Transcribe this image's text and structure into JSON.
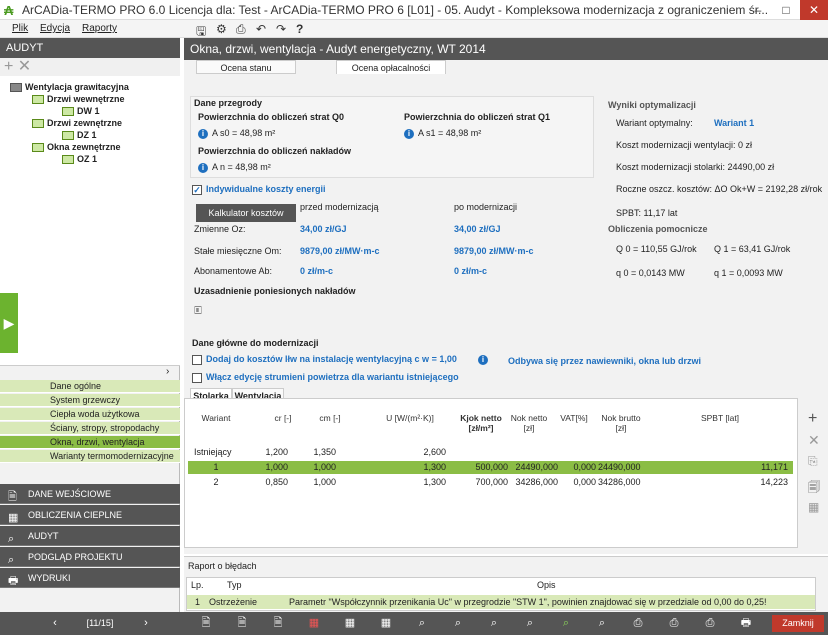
{
  "title": "ArCADia-TERMO PRO 6.0 Licencja dla: Test - ArCADia-TERMO PRO 6 [L01] - 05. Audyt - Kompleksowa modernizacja z ograniczeniem śr...",
  "menu": [
    "Plik",
    "Edycja",
    "Raporty"
  ],
  "left": {
    "header": "AUDYT",
    "tree": [
      "Wentylacja grawitacyjna",
      "Drzwi wewnętrzne",
      "DW 1",
      "Drzwi zewnętrzne",
      "DZ 1",
      "Okna zewnętrzne",
      "OZ 1"
    ],
    "nav": [
      "Dane ogólne",
      "System grzewczy",
      "Ciepła woda użytkowa",
      "Ściany, stropy, stropodachy",
      "Okna, drzwi, wentylacja",
      "Warianty termomodernizacyjne"
    ],
    "sections": [
      "DANE WEJŚCIOWE",
      "OBLICZENIA CIEPLNE",
      "AUDYT",
      "PODGLĄD PROJEKTU",
      "WYDRUKI"
    ]
  },
  "main": {
    "header": "Okna, drzwi, wentylacja - Audyt energetyczny, WT 2014",
    "tabs": [
      "Ocena stanu technicznego",
      "Ocena opłacalności"
    ],
    "dane_przegrody": "Dane przegrody",
    "q0_label": "Powierzchnia do obliczeń strat Q0",
    "q0": "A s0 = 48,98 m²",
    "q1_label": "Powierzchnia do obliczeń strat Q1",
    "q1": "A s1 = 48,98 m²",
    "nak_label": "Powierzchnia do obliczeń nakładów",
    "nak": "A n = 48,98 m²",
    "indyw": "Indywidualne koszty energii",
    "calc_btn": "Kalkulator kosztów",
    "przed": "przed modernizacją",
    "po": "po modernizacji",
    "zmienne": "Zmienne Oz:",
    "zmienne_przed": "34,00 zł/GJ",
    "zmienne_po": "34,00 zł/GJ",
    "stale": "Stałe miesięczne Om:",
    "stale_przed": "9879,00 zł/MW·m-c",
    "stale_po": "9879,00 zł/MW·m-c",
    "abon": "Abonamentowe Ab:",
    "abon_przed": "0 zł/m-c",
    "abon_po": "0 zł/m-c",
    "uzas": "Uzasadnienie poniesionych nakładów",
    "wyniki": "Wyniki optymalizacji",
    "wariant_opt": "Wariant optymalny:",
    "wariant_opt_val": "Wariant 1",
    "koszt_went": "Koszt modernizacji wentylacji: 0 zł",
    "koszt_stol": "Koszt modernizacji stolarki: 24490,00 zł",
    "roczne": "Roczne oszcz. kosztów: ΔO Ok+W = 2192,28 zł/rok",
    "spbt": "SPBT: 11,17 lat",
    "pomocnicze": "Obliczenia pomocnicze",
    "q0v": "Q 0 = 110,55 GJ/rok",
    "q1v": "Q 1 = 63,41 GJ/rok",
    "q0m": "q 0 = 0,0143 MW",
    "q1m": "q 1 = 0,0093 MW",
    "dane_glowne": "Dane główne do modernizacji",
    "dodaj": "Dodaj do kosztów lłw na instalację wentylacyjną  c w = 1,00",
    "odbywa": "Odbywa się przez nawiewniki, okna lub drzwi",
    "wlacz": "Włącz edycję strumieni powietrza dla wariantu istniejącego",
    "subtabs": [
      "Stolarka",
      "Wentylacja"
    ],
    "columns": [
      "Wariant",
      "cr [-]",
      "cm [-]",
      "U [W/(m²·K)]",
      "Kjok netto [zł/m²]",
      "Nok netto [zł]",
      "VAT[%]",
      "Nok brutto [zł]",
      "SPBT [lat]"
    ],
    "rows": [
      [
        "Istniejący",
        "1,200",
        "1,350",
        "2,600",
        "",
        "",
        "",
        "",
        ""
      ],
      [
        "1",
        "1,000",
        "1,000",
        "1,300",
        "500,000",
        "24490,000",
        "0,000",
        "24490,000",
        "11,171"
      ],
      [
        "2",
        "0,850",
        "1,000",
        "1,300",
        "700,000",
        "34286,000",
        "0,000",
        "34286,000",
        "14,223"
      ]
    ]
  },
  "raport": {
    "title": "Raport o błędach",
    "cols": [
      "Lp.",
      "Typ",
      "Opis"
    ],
    "row": [
      "1",
      "Ostrzeżenie",
      "Parametr \"Współczynnik przenikania Uc\" w przegrodzie \"STW 1\", powinien znajdować się w przedziale od 0,00 do 0,25!"
    ]
  },
  "bottom": {
    "page": "[11/15]",
    "close": "Zamknij"
  }
}
